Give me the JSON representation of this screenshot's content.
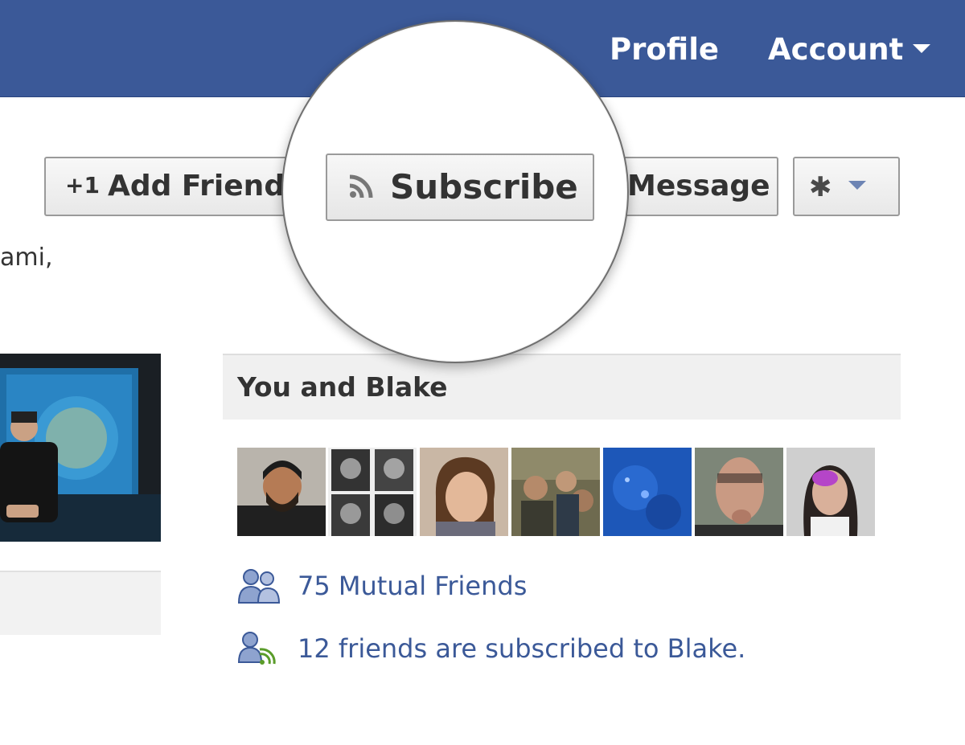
{
  "topbar": {
    "profile_label": "Profile",
    "account_label": "Account",
    "background_color": "#3b5998"
  },
  "actions": {
    "add_friend_prefix": "+1",
    "add_friend_label": "Add Friend",
    "subscribe_label": "Subscribe",
    "subscribe_icon": "rss-icon",
    "message_label": "Message",
    "message_visible_text": "Message",
    "settings_icon": "gear-icon"
  },
  "intro": {
    "visible_text": "ami,"
  },
  "sidebar": {
    "section_title": "You and Blake",
    "mutual_friends_text": "75 Mutual Friends",
    "mutual_friends_icon": "friends-icon",
    "subscribed_text": "12 friends are subscribed to Blake.",
    "subscribed_icon": "subscriber-icon",
    "link_color": "#3b5998"
  }
}
